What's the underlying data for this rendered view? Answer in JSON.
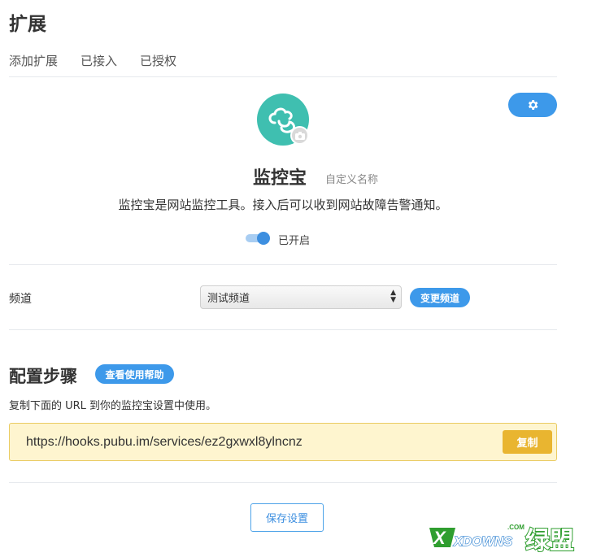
{
  "page": {
    "title": "扩展"
  },
  "tabs": [
    {
      "label": "添加扩展"
    },
    {
      "label": "已接入"
    },
    {
      "label": "已授权"
    }
  ],
  "extension": {
    "name": "监控宝",
    "custom_name_link": "自定义名称",
    "description": "监控宝是网站监控工具。接入后可以收到网站故障告警通知。",
    "enabled": true,
    "toggle_label": "已开启",
    "logo_color": "#3fbfb0"
  },
  "channel": {
    "label": "频道",
    "selected": "测试频道",
    "change_button": "变更频道"
  },
  "steps": {
    "title": "配置步骤",
    "help_button": "查看使用帮助",
    "description": "复制下面的 URL 到你的监控宝设置中使用。",
    "url": "https://hooks.pubu.im/services/ez2gxwxl8ylncnz",
    "copy_button": "复制"
  },
  "save_button": "保存设置",
  "watermark": {
    "brand": "XDOWNS",
    "suffix": ".COM",
    "cn": "绿盟"
  },
  "colors": {
    "accent": "#3d99ea",
    "url_bg": "#fef5cf",
    "copy_btn": "#e9b530"
  }
}
